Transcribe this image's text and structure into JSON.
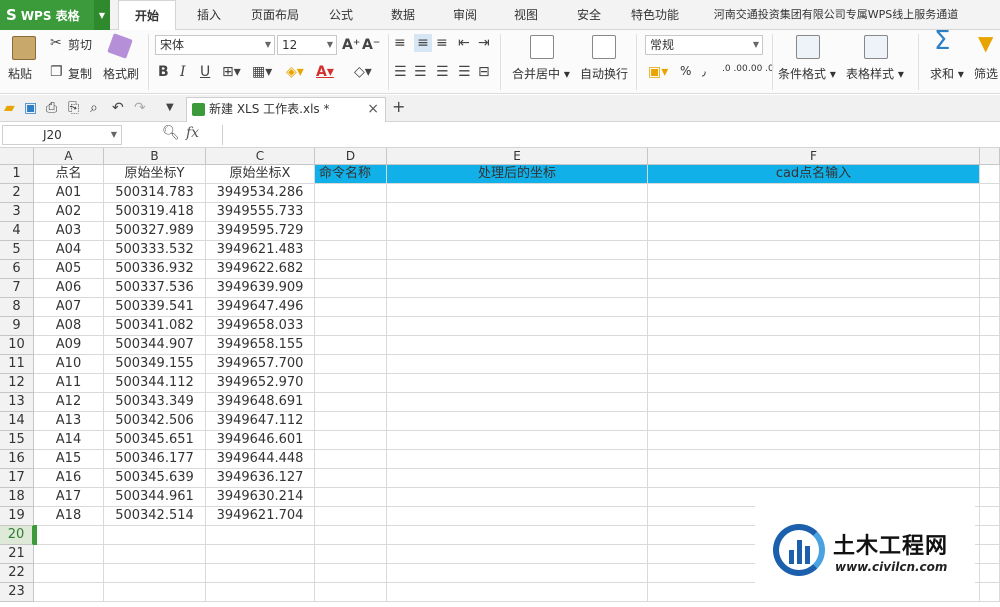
{
  "app": {
    "logo_mark": "S",
    "logo_text": "WPS 表格"
  },
  "menu_tabs": [
    {
      "label": "开始",
      "active": true
    },
    {
      "label": "插入"
    },
    {
      "label": "页面布局"
    },
    {
      "label": "公式"
    },
    {
      "label": "数据"
    },
    {
      "label": "审阅"
    },
    {
      "label": "视图"
    },
    {
      "label": "安全"
    },
    {
      "label": "特色功能"
    },
    {
      "label": "河南交通投资集团有限公司专属WPS线上服务通道"
    }
  ],
  "ribbon": {
    "paste": "粘贴",
    "cut": "剪切",
    "copy": "复制",
    "format_painter": "格式刷",
    "font_name": "宋体",
    "font_size": "12",
    "merge_center": "合并居中",
    "wrap_text": "自动换行",
    "number_format": "常规",
    "percent": "%",
    "comma": "٫",
    "inc_decimal": ".0 .00",
    "dec_decimal": ".00 .0",
    "cond_format": "条件格式",
    "table_style": "表格样式",
    "sum": "求和",
    "filter": "筛选"
  },
  "doc_tab": {
    "title": "新建 XLS 工作表.xls *"
  },
  "formula_bar": {
    "cell_ref": "J20",
    "fx": "fx",
    "value": ""
  },
  "columns": [
    "A",
    "B",
    "C",
    "D",
    "E",
    "F"
  ],
  "header_row": [
    "点名",
    "原始坐标Y",
    "原始坐标X",
    "命令名称",
    "处理后的坐标",
    "cad点名输入"
  ],
  "rows": [
    [
      "A01",
      "500314.783",
      "3949534.286"
    ],
    [
      "A02",
      "500319.418",
      "3949555.733"
    ],
    [
      "A03",
      "500327.989",
      "3949595.729"
    ],
    [
      "A04",
      "500333.532",
      "3949621.483"
    ],
    [
      "A05",
      "500336.932",
      "3949622.682"
    ],
    [
      "A06",
      "500337.536",
      "3949639.909"
    ],
    [
      "A07",
      "500339.541",
      "3949647.496"
    ],
    [
      "A08",
      "500341.082",
      "3949658.033"
    ],
    [
      "A09",
      "500344.907",
      "3949658.155"
    ],
    [
      "A10",
      "500349.155",
      "3949657.700"
    ],
    [
      "A11",
      "500344.112",
      "3949652.970"
    ],
    [
      "A12",
      "500343.349",
      "3949648.691"
    ],
    [
      "A13",
      "500342.506",
      "3949647.112"
    ],
    [
      "A14",
      "500345.651",
      "3949646.601"
    ],
    [
      "A15",
      "500346.177",
      "3949644.448"
    ],
    [
      "A16",
      "500345.639",
      "3949636.127"
    ],
    [
      "A17",
      "500344.961",
      "3949630.214"
    ],
    [
      "A18",
      "500342.514",
      "3949621.704"
    ]
  ],
  "row_numbers": [
    "1",
    "2",
    "3",
    "4",
    "5",
    "6",
    "7",
    "8",
    "9",
    "10",
    "11",
    "12",
    "13",
    "14",
    "15",
    "16",
    "17",
    "18",
    "19",
    "20",
    "21",
    "22",
    "23"
  ],
  "selected_row": "20",
  "watermark": {
    "cn": "土木工程网",
    "url": "www.civilcn.com"
  },
  "colors": {
    "header_fill": "#11b0e8",
    "brand": "#3b9b3a"
  }
}
